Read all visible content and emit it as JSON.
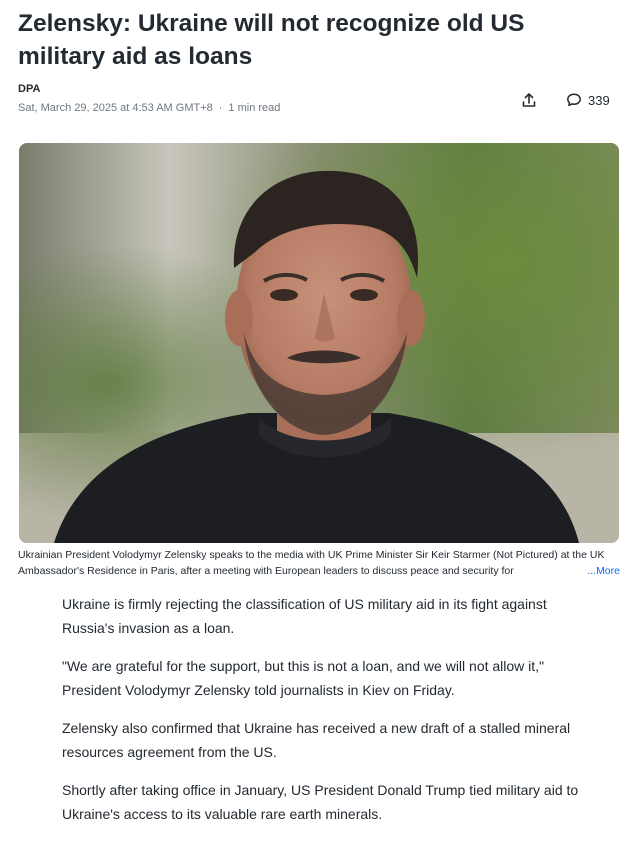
{
  "article": {
    "headline": "Zelensky: Ukraine will not recognize old US military aid as loans",
    "author": "DPA",
    "date": "Sat, March 29, 2025 at 4:53 AM GMT+8",
    "read_time": "1 min read",
    "comment_count": "339",
    "caption": "Ukrainian President Volodymyr Zelensky speaks to the media with UK Prime Minister Sir Keir Starmer (Not Pictured) at the UK Ambassador's Residence in Paris, after a meeting with European leaders to discuss peace and security for",
    "caption_more": "...More",
    "paragraphs": [
      "Ukraine is firmly rejecting the classification of US military aid in its fight against Russia's invasion as a loan.",
      "\"We are grateful for the support, but this is not a loan, and we will not allow it,\" President Volodymyr Zelensky told journalists in Kiev on Friday.",
      "Zelensky also confirmed that Ukraine has received a new draft of a stalled mineral resources agreement from the US.",
      "Shortly after taking office in January, US President Donald Trump tied military aid to Ukraine's access to its valuable rare earth minerals."
    ]
  },
  "icons": {
    "share": "share-icon",
    "comment": "comment-icon"
  },
  "colors": {
    "link": "#0f69ff",
    "meta": "#6e7780",
    "text": "#232a31"
  }
}
